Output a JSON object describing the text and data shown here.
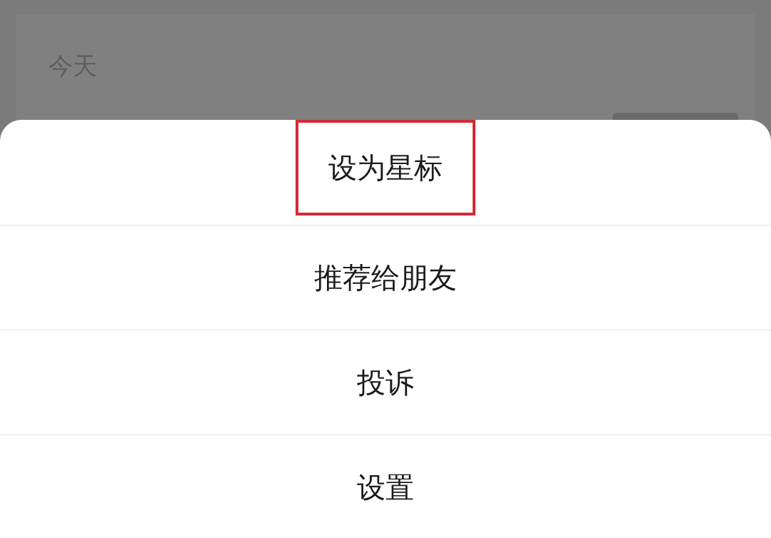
{
  "background": {
    "section_label": "今天"
  },
  "action_sheet": {
    "items": [
      {
        "label": "设为星标",
        "highlighted": true
      },
      {
        "label": "推荐给朋友",
        "highlighted": false
      },
      {
        "label": "投诉",
        "highlighted": false
      },
      {
        "label": "设置",
        "highlighted": false
      }
    ]
  }
}
